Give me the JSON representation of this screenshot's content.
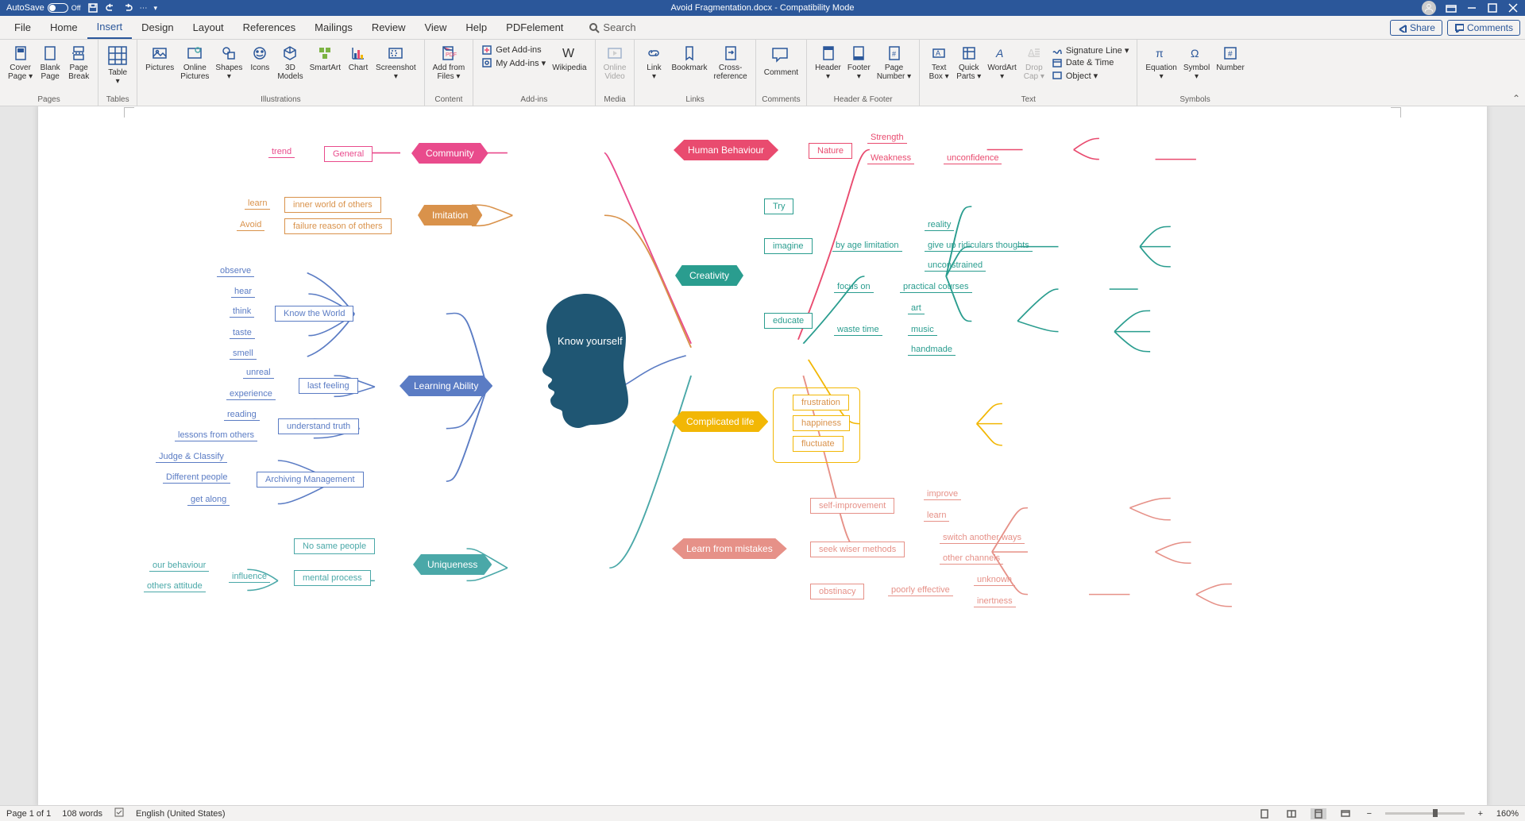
{
  "titlebar": {
    "autosave_label": "AutoSave",
    "autosave_state": "Off",
    "doc_title": "Avoid Fragmentation.docx  -  Compatibility Mode"
  },
  "tabs": {
    "file": "File",
    "home": "Home",
    "insert": "Insert",
    "design": "Design",
    "layout": "Layout",
    "references": "References",
    "mailings": "Mailings",
    "review": "Review",
    "view": "View",
    "help": "Help",
    "pdfelement": "PDFelement",
    "search": "Search",
    "share": "Share",
    "comments": "Comments"
  },
  "ribbon": {
    "groups": {
      "pages": "Pages",
      "tables": "Tables",
      "illustrations": "Illustrations",
      "content": "Content",
      "addins": "Add-ins",
      "media": "Media",
      "links": "Links",
      "comments": "Comments",
      "header_footer": "Header & Footer",
      "text": "Text",
      "symbols": "Symbols"
    },
    "cover_page": "Cover\nPage ▾",
    "blank_page": "Blank\nPage",
    "page_break": "Page\nBreak",
    "table": "Table\n▾",
    "pictures": "Pictures",
    "online_pictures": "Online\nPictures",
    "shapes": "Shapes\n▾",
    "icons": "Icons",
    "models_3d": "3D\nModels",
    "smartart": "SmartArt",
    "chart": "Chart",
    "screenshot": "Screenshot\n▾",
    "add_from_files": "Add from\nFiles ▾",
    "get_addins": "Get Add-ins",
    "my_addins": "My Add-ins  ▾",
    "wikipedia": "Wikipedia",
    "online_video": "Online\nVideo",
    "link": "Link\n▾",
    "bookmark": "Bookmark",
    "cross_reference": "Cross-\nreference",
    "comment": "Comment",
    "header": "Header\n▾",
    "footer": "Footer\n▾",
    "page_number": "Page\nNumber ▾",
    "text_box": "Text\nBox ▾",
    "quick_parts": "Quick\nParts ▾",
    "wordart": "WordArt\n▾",
    "drop_cap": "Drop\nCap ▾",
    "signature_line": "Signature Line  ▾",
    "date_time": "Date & Time",
    "object": "Object  ▾",
    "equation": "Equation\n▾",
    "symbol": "Symbol\n▾",
    "number": "Number"
  },
  "mindmap": {
    "center": "Know yourself",
    "community": {
      "title": "Community",
      "general": "General",
      "trend": "trend"
    },
    "imitation": {
      "title": "Imitation",
      "inner": "inner world of others",
      "learn": "learn",
      "failure": "failure reason of others",
      "avoid": "Avoid"
    },
    "learning": {
      "title": "Learning Ability",
      "know_world": "Know the World",
      "senses": [
        "observe",
        "hear",
        "think",
        "taste",
        "smell"
      ],
      "last_feeling": "last feeling",
      "unreal": "unreal",
      "experience": "experience",
      "understand": "understand truth",
      "reading": "reading",
      "lessons": "lessons from others",
      "archiving": "Archiving Management",
      "judge": "Judge & Classify",
      "different": "Different people",
      "get_along": "get along"
    },
    "uniqueness": {
      "title": "Uniqueness",
      "no_same": "No same people",
      "mental": "mental process",
      "influence": "influence",
      "our_behaviour": "our behaviour",
      "others_attitude": "others attitude"
    },
    "human_behaviour": {
      "title": "Human Behaviour",
      "nature": "Nature",
      "strength": "Strength",
      "weakness": "Weakness",
      "unconfidence": "unconfidence"
    },
    "creativity": {
      "title": "Creativity",
      "try": "Try",
      "imagine": "imagine",
      "by_age": "by age limitation",
      "reality": "reality",
      "giveup": "give up ridiculars thoughts",
      "unconstrained": "unconstrained",
      "educate": "educate",
      "focus_on": "focus on",
      "practical": "practical courses",
      "waste_time": "waste time",
      "art": "art",
      "music": "music",
      "handmade": "handmade"
    },
    "complicated": {
      "title": "Complicated life",
      "frustration": "frustration",
      "happiness": "happiness",
      "fluctuate": "fluctuate"
    },
    "mistakes": {
      "title": "Learn from mistakes",
      "self_improvement": "self-improvement",
      "improve": "improve",
      "learn": "learn",
      "seek": "seek wiser methods",
      "switch": "switch another ways",
      "other_channels": "other channels",
      "obstinacy": "obstinacy",
      "poorly": "poorly effective",
      "unknown": "unknown",
      "inertness": "inertness"
    }
  },
  "status": {
    "page": "Page 1 of 1",
    "words": "108 words",
    "language": "English (United States)",
    "zoom": "160%"
  },
  "colors": {
    "community": "#e94b8c",
    "imitation": "#d9924b",
    "learning": "#5b7cc4",
    "uniqueness": "#4aa8a8",
    "human_behaviour": "#e94b6f",
    "creativity": "#2a9d8f",
    "complicated": "#f2b705",
    "mistakes": "#e69188",
    "head": "#1f5673"
  }
}
